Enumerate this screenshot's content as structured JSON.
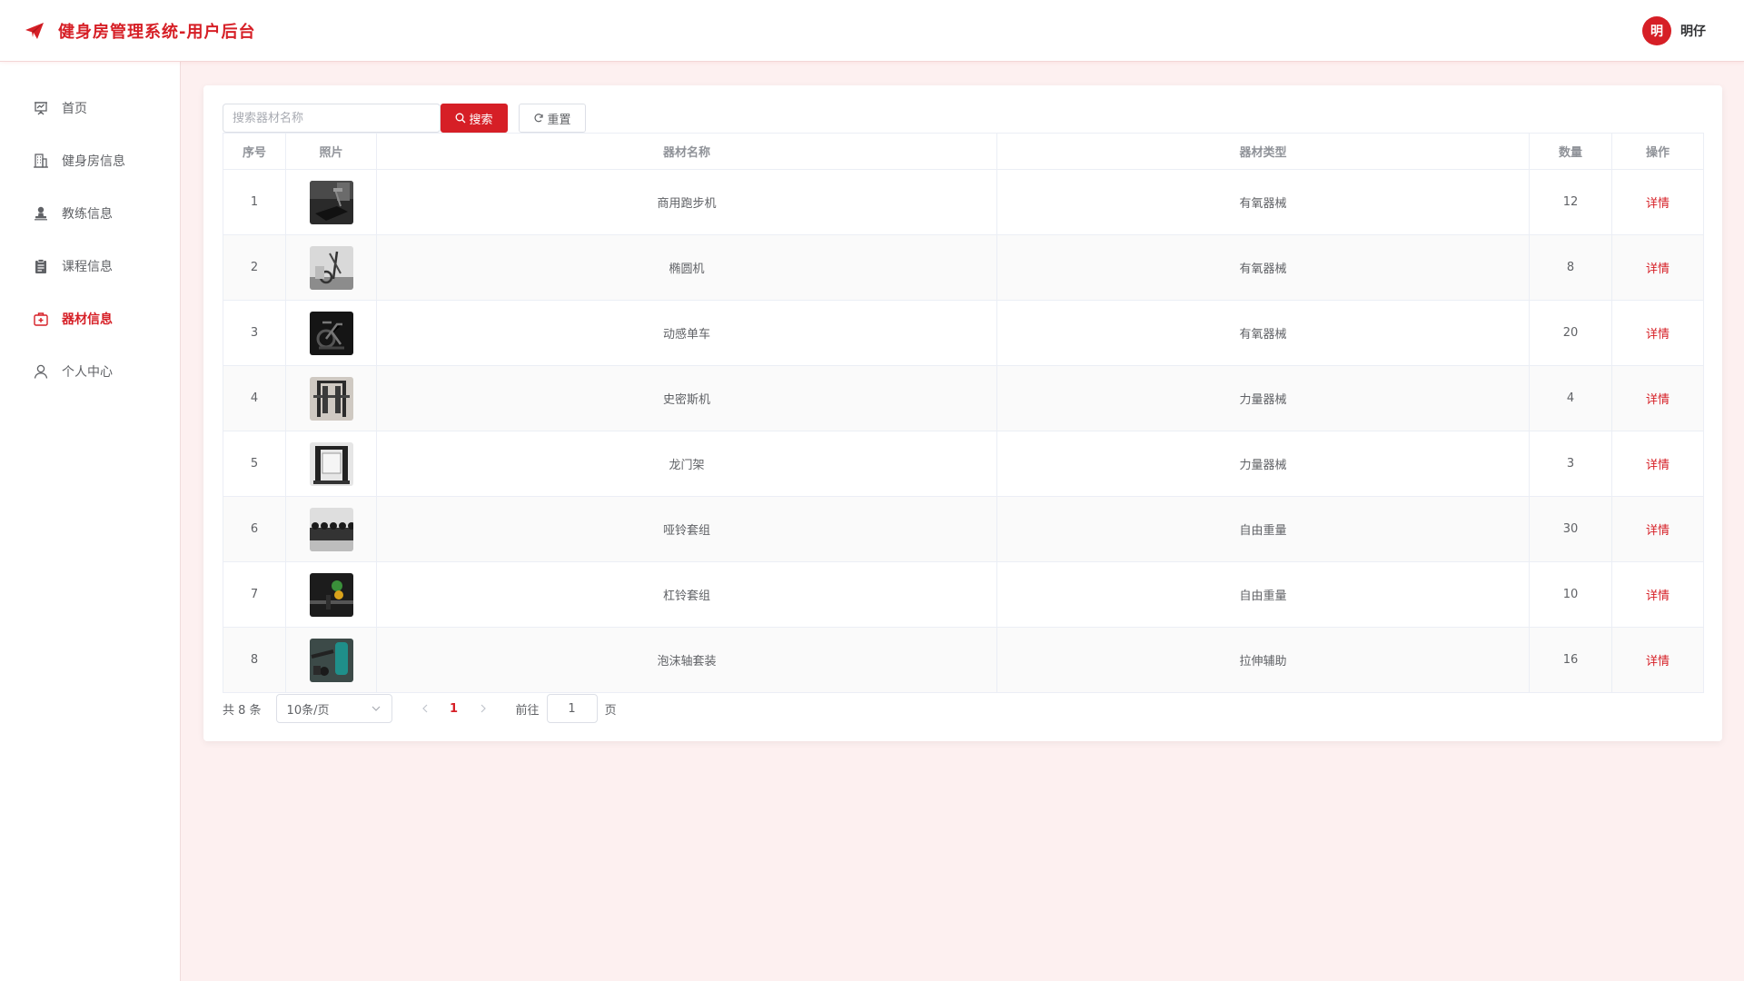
{
  "header": {
    "title": "健身房管理系统-用户后台",
    "avatar_text": "明",
    "username": "明仔"
  },
  "colors": {
    "accent": "#d61f26",
    "background": "#fdf0f0"
  },
  "sidebar": {
    "items": [
      {
        "label": "首页",
        "icon": "presentation-icon",
        "active": false
      },
      {
        "label": "健身房信息",
        "icon": "building-icon",
        "active": false
      },
      {
        "label": "教练信息",
        "icon": "person-stamp-icon",
        "active": false
      },
      {
        "label": "课程信息",
        "icon": "clipboard-icon",
        "active": false
      },
      {
        "label": "器材信息",
        "icon": "toolbox-icon",
        "active": true
      },
      {
        "label": "个人中心",
        "icon": "user-icon",
        "active": false
      }
    ]
  },
  "toolbar": {
    "search_placeholder": "搜索器材名称",
    "search_value": "",
    "search_label": "搜索",
    "reset_label": "重置"
  },
  "table": {
    "columns": [
      "序号",
      "照片",
      "器材名称",
      "器材类型",
      "数量",
      "操作"
    ],
    "rows": [
      {
        "index": "1",
        "photo": "treadmill-photo",
        "name": "商用跑步机",
        "type": "有氧器械",
        "qty": "12",
        "action": "详情"
      },
      {
        "index": "2",
        "photo": "elliptical-photo",
        "name": "椭圆机",
        "type": "有氧器械",
        "qty": "8",
        "action": "详情"
      },
      {
        "index": "3",
        "photo": "spin-bike-photo",
        "name": "动感单车",
        "type": "有氧器械",
        "qty": "20",
        "action": "详情"
      },
      {
        "index": "4",
        "photo": "smith-machine-photo",
        "name": "史密斯机",
        "type": "力量器械",
        "qty": "4",
        "action": "详情"
      },
      {
        "index": "5",
        "photo": "gantry-photo",
        "name": "龙门架",
        "type": "力量器械",
        "qty": "3",
        "action": "详情"
      },
      {
        "index": "6",
        "photo": "dumbbell-set-photo",
        "name": "哑铃套组",
        "type": "自由重量",
        "qty": "30",
        "action": "详情"
      },
      {
        "index": "7",
        "photo": "barbell-set-photo",
        "name": "杠铃套组",
        "type": "自由重量",
        "qty": "10",
        "action": "详情"
      },
      {
        "index": "8",
        "photo": "foam-roller-photo",
        "name": "泡沫轴套装",
        "type": "拉伸辅助",
        "qty": "16",
        "action": "详情"
      }
    ]
  },
  "pagination": {
    "total_text": "共 8 条",
    "page_size": "10条/页",
    "current_page": "1",
    "goto_label": "前往",
    "goto_value": "1",
    "goto_suffix": "页"
  }
}
